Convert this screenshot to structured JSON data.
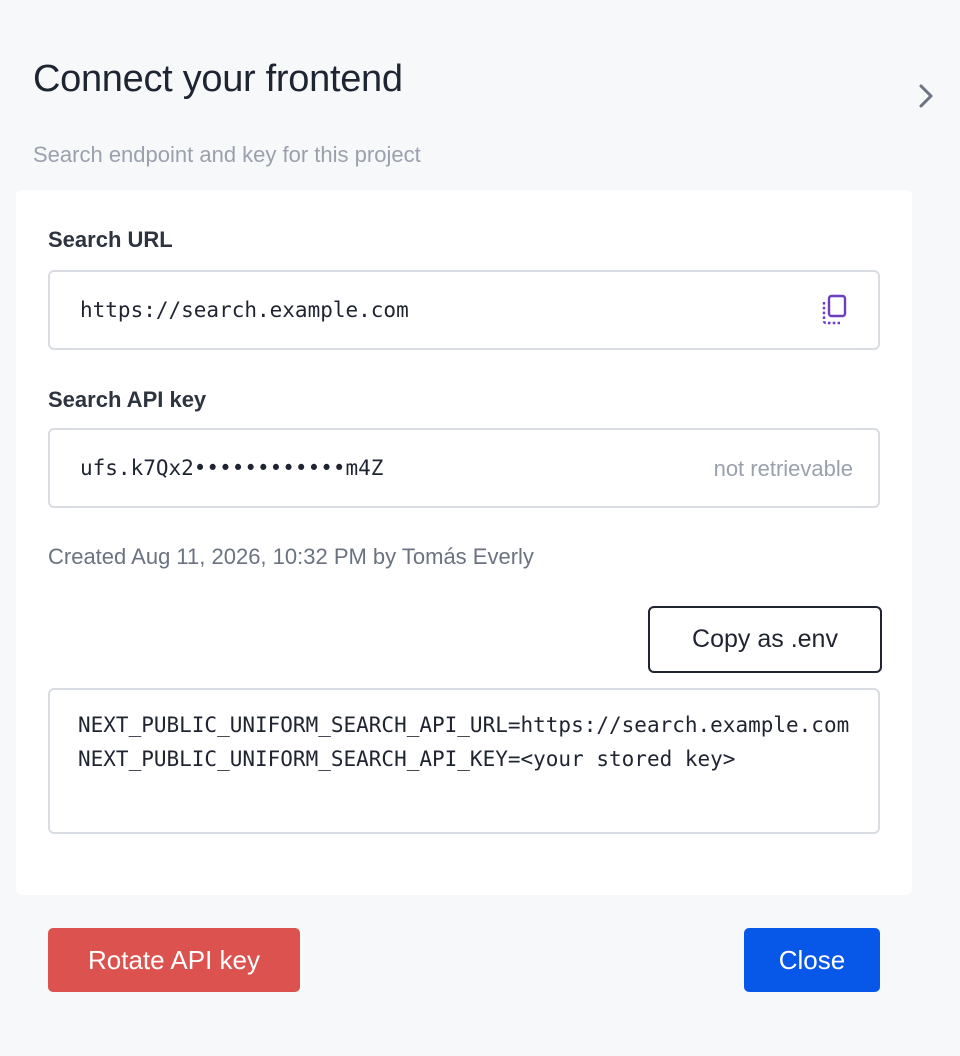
{
  "dialog": {
    "title": "Connect your frontend",
    "subtitle": "Search endpoint and key for this project"
  },
  "search_url": {
    "label": "Search URL",
    "value": "https://search.example.com",
    "copy_icon": "copy-icon"
  },
  "search_api_key": {
    "label": "Search API key",
    "value": "ufs.k7Qx2••••••••••••m4Z",
    "hint": "not retrievable"
  },
  "created_meta": "Created Aug 11, 2026, 10:32 PM by Tomás Everly",
  "copy_env_button": "Copy as .env",
  "env_snippet": {
    "line1": "NEXT_PUBLIC_UNIFORM_SEARCH_API_URL=https://search.example.com",
    "line2": "NEXT_PUBLIC_UNIFORM_SEARCH_API_KEY=<your stored key>"
  },
  "footer": {
    "rotate_button": "Rotate API key",
    "close_button": "Close"
  },
  "colors": {
    "primary": "#0757e8",
    "danger": "#dc524f",
    "icon_accent": "#6d3fc0"
  }
}
